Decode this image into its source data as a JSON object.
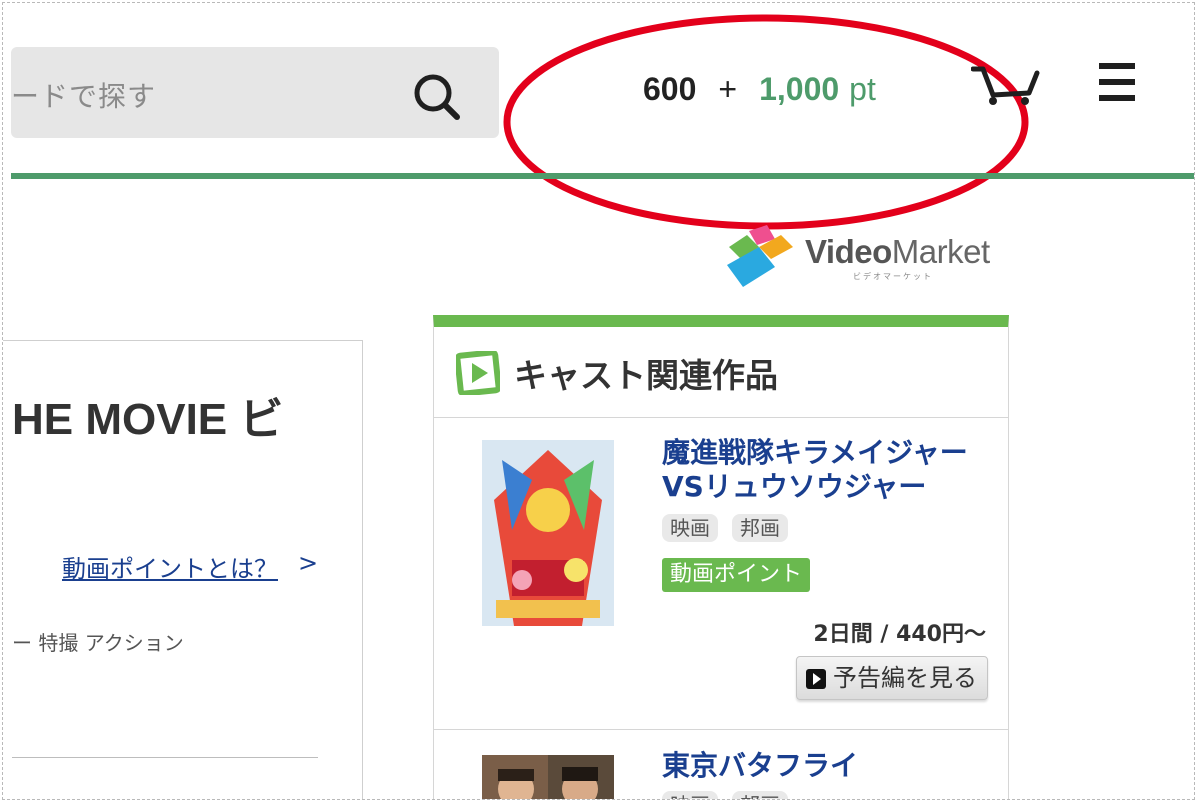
{
  "header": {
    "search_placeholder": "ードで探す",
    "points_base": "600",
    "points_plus": "+",
    "points_bonus": "1,000",
    "points_unit": "pt"
  },
  "logo": {
    "brand_a": "Video",
    "brand_b": "Market",
    "sub": "ビデオマーケット"
  },
  "left": {
    "movie_title": "HE MOVIE ビ",
    "point_link": "動画ポイントとは？",
    "point_link_arrow": ">",
    "genres": "ー 特撮 アクション"
  },
  "cast_section": {
    "title": "キャスト関連作品",
    "items": [
      {
        "title": "魔進戦隊キラメイジャー\nVSリュウソウジャー",
        "tags": [
          "映画",
          "邦画"
        ],
        "badge": "動画ポイント",
        "price": "2日間 / 440円〜",
        "trailer_label": "予告編を見る"
      },
      {
        "title": "東京バタフライ",
        "tags": [
          "映画",
          "邦画"
        ]
      }
    ]
  },
  "colors": {
    "accent_green": "#6ab94f",
    "header_line": "#4e9b6b",
    "link_blue": "#1a3f8f",
    "highlight_red": "#e3001b"
  }
}
